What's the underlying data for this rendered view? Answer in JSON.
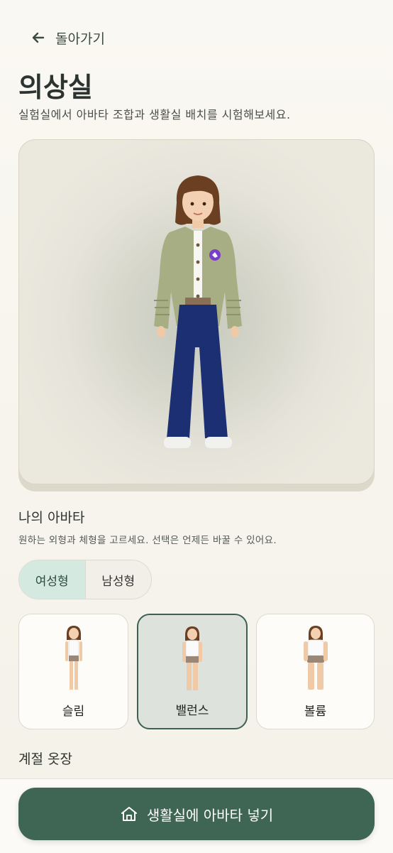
{
  "header": {
    "back_label": "돌아가기"
  },
  "page": {
    "title": "의상실",
    "subtitle": "실험실에서 아바타 조합과 생활실 배치를 시험해보세요."
  },
  "avatar_section": {
    "title": "나의 아바타",
    "description": "원하는 외형과 체형을 고르세요. 선택은 언제든 바꿀 수 있어요.",
    "gender_options": [
      {
        "label": "여성형",
        "selected": true
      },
      {
        "label": "남성형",
        "selected": false
      }
    ],
    "body_types": [
      {
        "label": "슬림",
        "selected": false
      },
      {
        "label": "밸런스",
        "selected": true
      },
      {
        "label": "볼륨",
        "selected": false
      }
    ]
  },
  "wardrobe": {
    "title": "계절 옷장"
  },
  "cta": {
    "label": "생활실에 아바타 넣기",
    "icon": "home-icon"
  },
  "colors": {
    "accent": "#3f6555",
    "selected_toggle": "#d4e9df"
  }
}
